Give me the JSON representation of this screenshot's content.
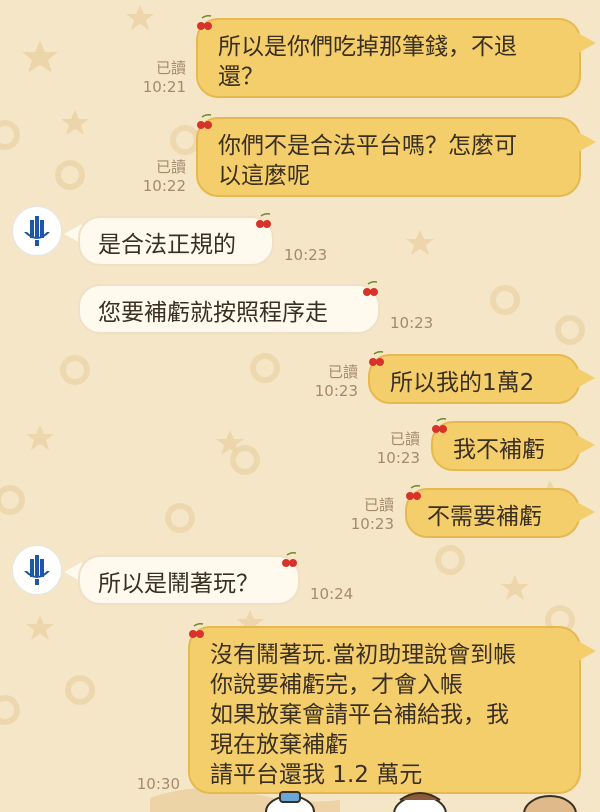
{
  "colors": {
    "background": "#f6e6c8",
    "outgoing_bubble": "#f4ce6b",
    "incoming_bubble": "#fff9ee",
    "meta_text": "#a48a6a",
    "avatar_blue": "#1f57a8"
  },
  "messages": [
    {
      "side": "out",
      "text": "所以是你們吃掉那筆錢，不退\n還？",
      "read": "已讀",
      "time": "10:21"
    },
    {
      "side": "out",
      "text": "你們不是合法平台嗎？怎麼可\n以這麼呢",
      "read": "已讀",
      "time": "10:22"
    },
    {
      "side": "in",
      "text": "是合法正規的",
      "time": "10:23",
      "show_avatar": true
    },
    {
      "side": "in",
      "text": "您要補虧就按照程序走",
      "time": "10:23",
      "show_avatar": false
    },
    {
      "side": "out",
      "text": "所以我的1萬2",
      "read": "已讀",
      "time": "10:23"
    },
    {
      "side": "out",
      "text": "我不補虧",
      "read": "已讀",
      "time": "10:23"
    },
    {
      "side": "out",
      "text": "不需要補虧",
      "read": "已讀",
      "time": "10:23"
    },
    {
      "side": "in",
      "text": "所以是鬧著玩？",
      "time": "10:24",
      "show_avatar": true
    },
    {
      "side": "out",
      "text": "沒有鬧著玩.當初助理說會到帳\n你說要補虧完，才會入帳\n如果放棄會請平台補給我，我\n現在放棄補虧\n請平台還我 1.2 萬元",
      "read": "",
      "time": "10:30"
    }
  ]
}
